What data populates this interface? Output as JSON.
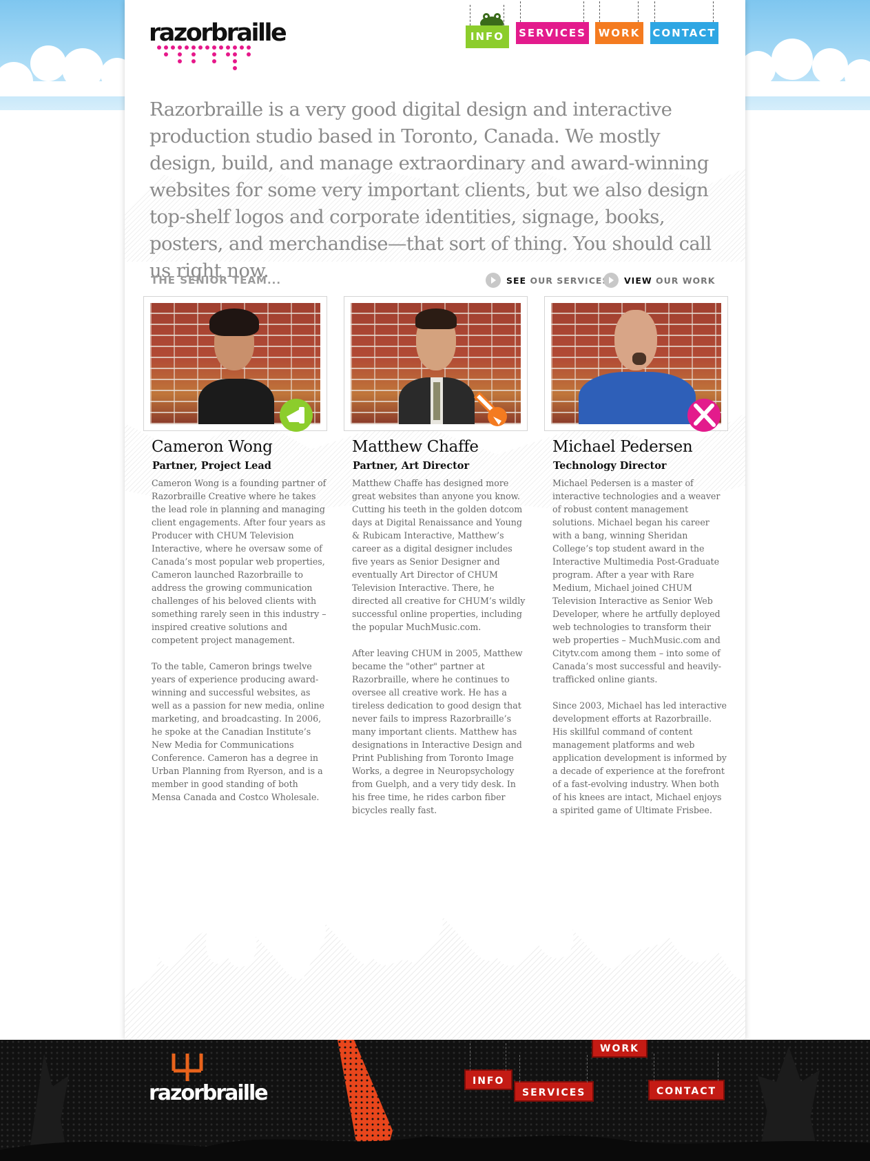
{
  "site": {
    "logo_text": "razorbraille",
    "footer_logo_text": "razorbraille"
  },
  "nav": {
    "items": [
      {
        "label": "INFO",
        "color": "#8ccd2c",
        "active": true
      },
      {
        "label": "SERVICES",
        "color": "#e31b8c"
      },
      {
        "label": "WORK",
        "color": "#f47b20"
      },
      {
        "label": "CONTACT",
        "color": "#2ea6e3"
      }
    ]
  },
  "intro": {
    "text": "Razorbraille is a very good digital design and interactive production studio based in Toronto, Canada. We mostly design, build, and manage extraordinary and award-winning websites for some very important clients, but we also design top-shelf logos and corporate identities, signage, books, posters, and merchandise—that sort of thing. You should call us right now."
  },
  "team": {
    "heading": "THE SENIOR TEAM...",
    "links": [
      {
        "bold": "SEE",
        "rest": " OUR SERVICES",
        "icon": "arrow-right-icon"
      },
      {
        "bold": "VIEW",
        "rest": " OUR WORK",
        "icon": "arrow-right-icon"
      }
    ],
    "members": [
      {
        "name": "Cameron Wong",
        "role": "Partner, Project Lead",
        "badge_icon": "megaphone-icon",
        "badge_color": "#8ccd2c",
        "bio": [
          "Cameron Wong is a founding partner of Razorbraille Creative where he takes the lead role in planning and managing client engagements. After four years as Producer with CHUM Television Interactive, where he oversaw some of Canada’s most popular web properties, Cameron launched Razorbraille to address the growing communication challenges of his beloved clients with something rarely seen in this industry – inspired creative solutions and competent project management.",
          "To the table, Cameron brings twelve years of experience producing award-winning and successful websites, as well as a passion for new media, online marketing, and broadcasting. In 2006, he spoke at the Canadian Institute’s New Media for Communications Conference. Cameron has a degree in Urban Planning from Ryerson, and is a member in good standing of both Mensa Canada and Costco Wholesale."
        ]
      },
      {
        "name": "Matthew Chaffe",
        "role": "Partner, Art Director",
        "badge_icon": "paintbrush-icon",
        "badge_color": "#f47b20",
        "bio": [
          "Matthew Chaffe has designed more great websites than anyone you know. Cutting his teeth in the golden dotcom days at Digital Renaissance and Young & Rubicam Interactive, Matthew’s career as a digital designer includes five years as Senior Designer and eventually Art Director of CHUM Television Interactive. There, he directed all creative for CHUM’s wildly successful online properties, including the popular MuchMusic.com.",
          "After leaving CHUM in 2005, Matthew became the \"other\" partner at Razorbraille, where he continues to oversee all creative work. He has a tireless dedication to good design that never fails to impress Razorbraille’s many important clients. Matthew has designations in Interactive Design and Print Publishing from Toronto Image Works, a degree in Neuropsychology from Guelph, and a very tidy desk. In his free time, he rides carbon fiber bicycles really fast."
        ]
      },
      {
        "name": "Michael Pedersen",
        "role": "Technology Director",
        "badge_icon": "tools-icon",
        "badge_color": "#e31b8c",
        "bio": [
          "Michael Pedersen is a master of interactive technologies and a weaver of robust content management solutions. Michael began his career with a bang, winning Sheridan College’s top student award in the Interactive Multimedia Post-Graduate program. After a year with Rare Medium, Michael joined CHUM Television Interactive as Senior Web Developer, where he artfully deployed web technologies to transform their web properties – MuchMusic.com and Citytv.com among them – into some of Canada’s most successful and heavily-trafficked online giants.",
          "Since 2003, Michael has led interactive development efforts at Razorbraille. His skillful command of content management platforms and web application development is informed by a decade of experience at the forefront of a fast-evolving industry. When both of his knees are intact, Michael enjoys a spirited game of Ultimate Frisbee."
        ]
      }
    ]
  },
  "footer": {
    "nav": [
      "INFO",
      "SERVICES",
      "WORK",
      "CONTACT"
    ],
    "sign_color": "#c41b14"
  }
}
